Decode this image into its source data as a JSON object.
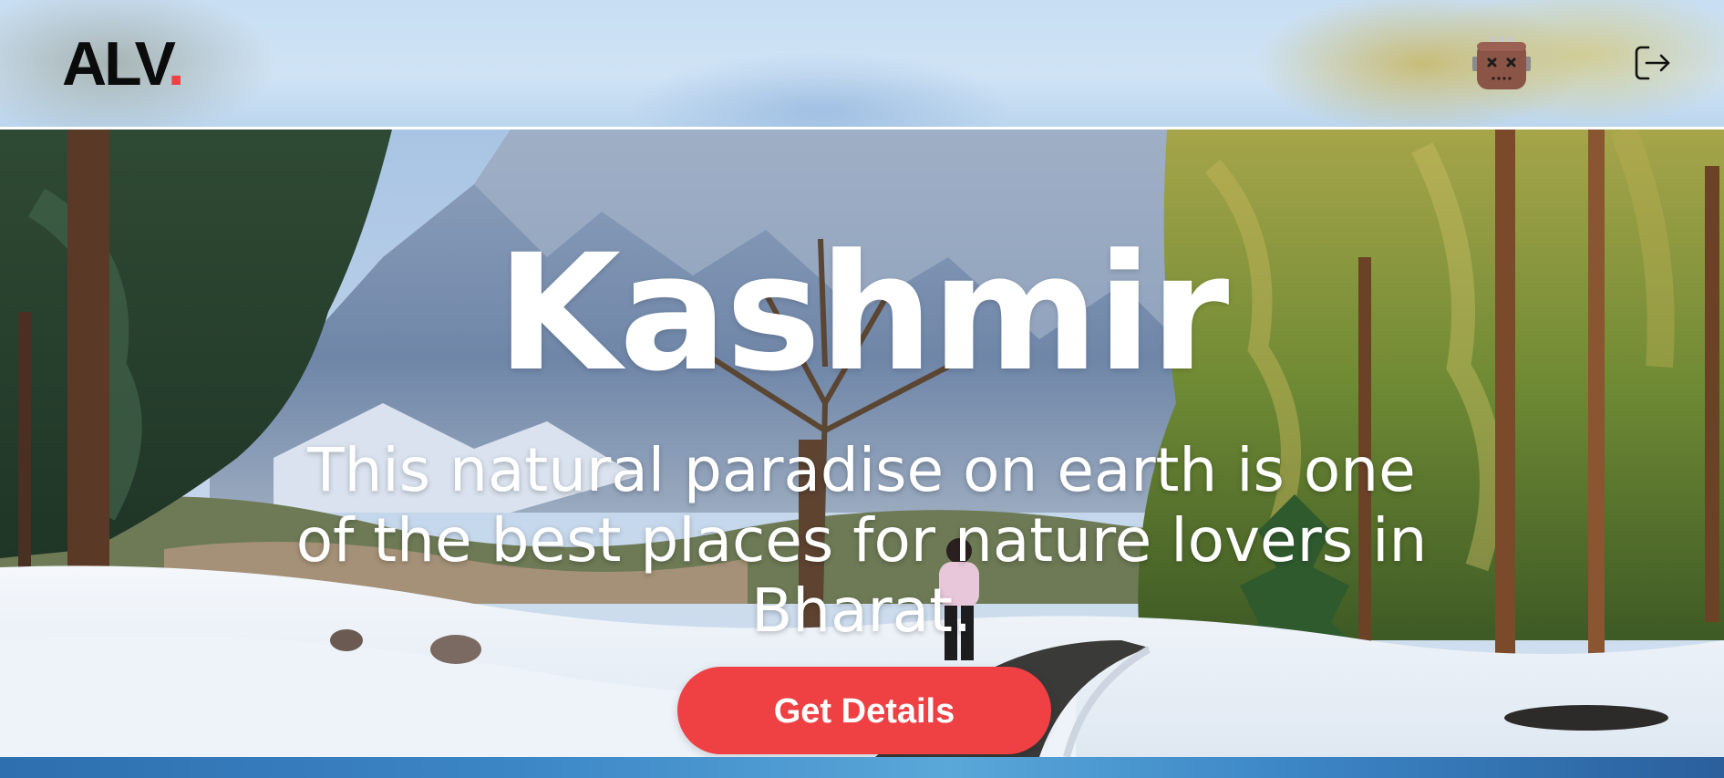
{
  "header": {
    "logo_text": "ALV",
    "logo_dot": ".",
    "avatar_icon": "robot-avatar-icon",
    "logout_icon": "logout-icon"
  },
  "hero": {
    "title": "Kashmir",
    "subtitle": "This natural paradise on earth is one of the best places for nature lovers in Bharat.",
    "cta_label": "Get Details"
  },
  "colors": {
    "accent": "#ef4044",
    "logo_text": "#0b0b0b",
    "hero_text": "#ffffff"
  }
}
